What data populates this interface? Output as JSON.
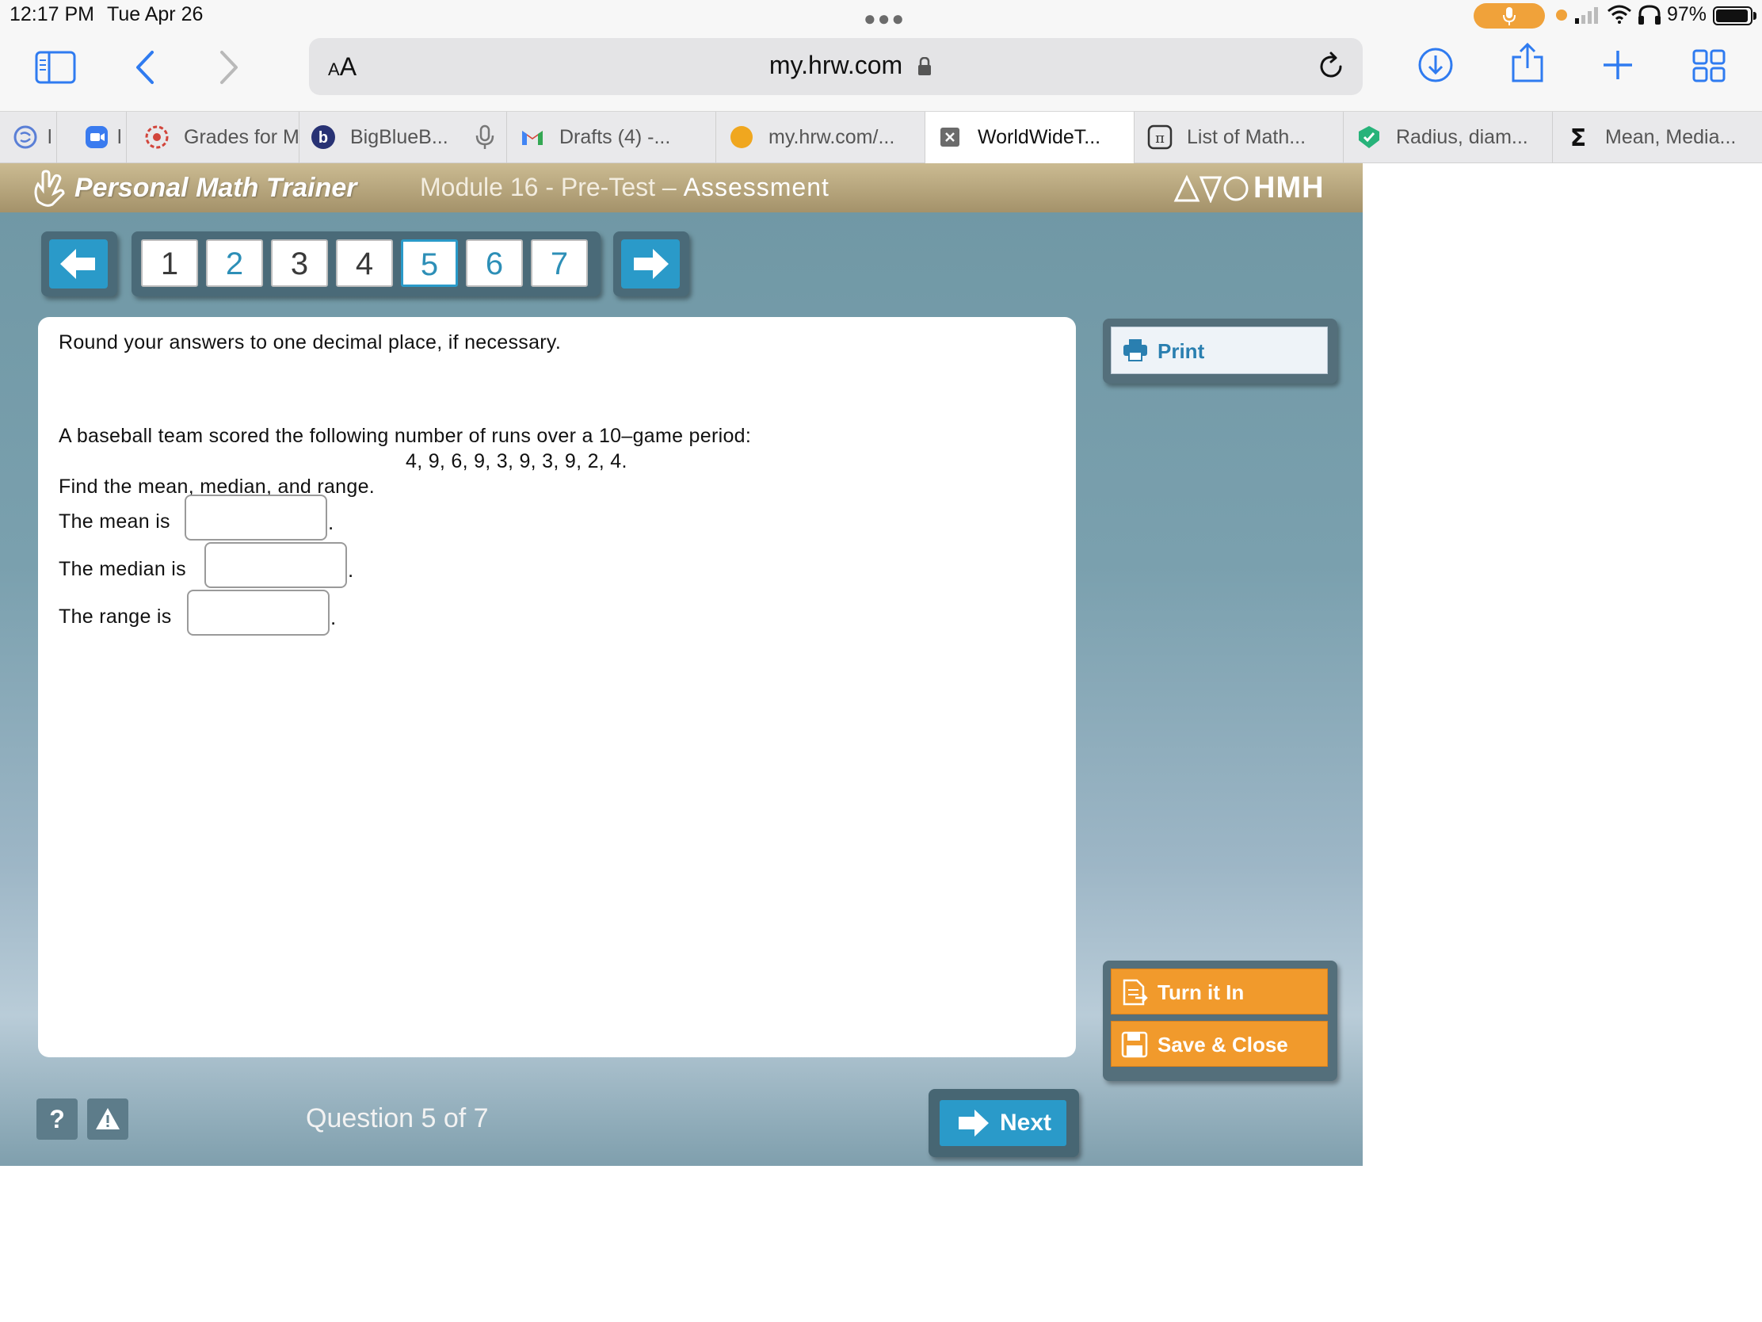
{
  "status_bar": {
    "time": "12:17 PM",
    "date": "Tue Apr 26",
    "battery": "97%"
  },
  "browser": {
    "text_size_label": "AA",
    "url": "my.hrw.com",
    "tabs": [
      {
        "label": "l",
        "active": false
      },
      {
        "label": "l",
        "active": false
      },
      {
        "label": "Grades for M",
        "active": false
      },
      {
        "label": "BigBlueB...",
        "active": false
      },
      {
        "label": "Drafts (4) -...",
        "active": false
      },
      {
        "label": "my.hrw.com/...",
        "active": false
      },
      {
        "label": "WorldWideT...",
        "active": true
      },
      {
        "label": "List of Math...",
        "active": false
      },
      {
        "label": "Radius, diam...",
        "active": false
      },
      {
        "label": "Mean, Media...",
        "active": false
      }
    ]
  },
  "app": {
    "brand": "Personal Math Trainer",
    "module": "Module 16 - Pre-Test –",
    "section": "Assessment",
    "publisher": "HMH",
    "question_numbers": [
      "1",
      "2",
      "3",
      "4",
      "5",
      "6",
      "7"
    ],
    "current_question": 5,
    "instructions": "Round your answers to one decimal place, if necessary.",
    "problem_line1": "A baseball team scored the following number of runs over a 10–game period:",
    "problem_data": "4, 9, 6, 9, 3, 9, 3, 9, 2, 4.",
    "problem_line2": "Find the mean, median, and range.",
    "mean_label": "The mean is",
    "median_label": "The median is",
    "range_label": "The range is",
    "mean_value": "",
    "median_value": "",
    "range_value": "",
    "period": ".",
    "print_label": "Print",
    "turn_in_label": "Turn it In",
    "save_close_label": "Save & Close",
    "help_label": "?",
    "question_count": "Question 5 of 7",
    "next_label": "Next"
  },
  "colors": {
    "accent_blue": "#2a9ac9",
    "orange": "#f19a2c",
    "header_tan": "#b5a47b"
  }
}
